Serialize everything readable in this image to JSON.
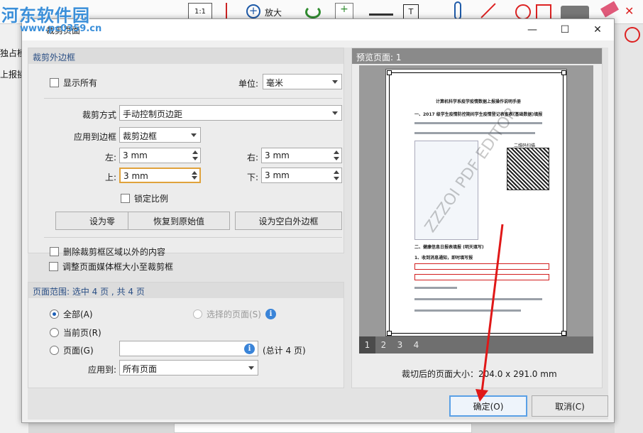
{
  "app": {
    "toolbar_labels": [
      "1:1",
      "放大"
    ],
    "left_labels": [
      "独占模式",
      "上报操作"
    ]
  },
  "watermark": {
    "title": "河东软件园",
    "url": "www.pc0359.cn"
  },
  "dialog": {
    "title": "裁剪页面",
    "crop_section": {
      "header": "裁剪外边框",
      "show_all_label": "显示所有",
      "unit_label": "单位:",
      "unit_value": "毫米",
      "crop_mode_label": "裁剪方式",
      "crop_mode_value": "手动控制页边距",
      "apply_to_box_label": "应用到边框",
      "apply_to_box_value": "裁剪边框",
      "left_label": "左:",
      "left_value": "3 mm",
      "right_label": "右:",
      "right_value": "3 mm",
      "top_label": "上:",
      "top_value": "3 mm",
      "bottom_label": "下:",
      "bottom_value": "3 mm",
      "lock_ratio_label": "锁定比例",
      "btn_zero": "设为零",
      "btn_restore": "恢复到原始值",
      "btn_blank": "设为空白外边框",
      "delete_outside_label": "删除裁剪框区域以外的内容",
      "adjust_media_label": "调整页面媒体框大小至裁剪框"
    },
    "range_section": {
      "header": "页面范围: 选中 4 页 , 共 4 页",
      "all_label": "全部(A)",
      "selected_label": "选择的页面(S)",
      "current_label": "当前页(R)",
      "pages_label": "页面(G)",
      "pages_value": "",
      "total_label": "(总计 4 页)",
      "apply_to_label": "应用到:",
      "apply_to_value": "所有页面"
    },
    "preview": {
      "header": "预览页面: 1",
      "page_tabs": [
        "1",
        "2",
        "3",
        "4"
      ],
      "size_text": "裁切后的页面大小：204.0 x 291.0 mm",
      "doc_title": "计算机科学系疫学疫情数据上报操作说明手册",
      "doc_heading1": "一、2017 级学生疫情防控期间学生疫情登记表查表(基础数据)填报",
      "doc_heading2": "二、健康信息日报表填报 (明天填写)",
      "doc_sub": "1、收到消息通知，即时填写报",
      "doc_watermark": "ZZZOI  PDF EDITOR",
      "qr_caption": "二维码扫描"
    },
    "ok_button": "确定(O)",
    "cancel_button": "取消(C)"
  },
  "colors": {
    "accent": "#2b4f85",
    "arrow": "#e01818",
    "focus": "#e0a23c"
  }
}
